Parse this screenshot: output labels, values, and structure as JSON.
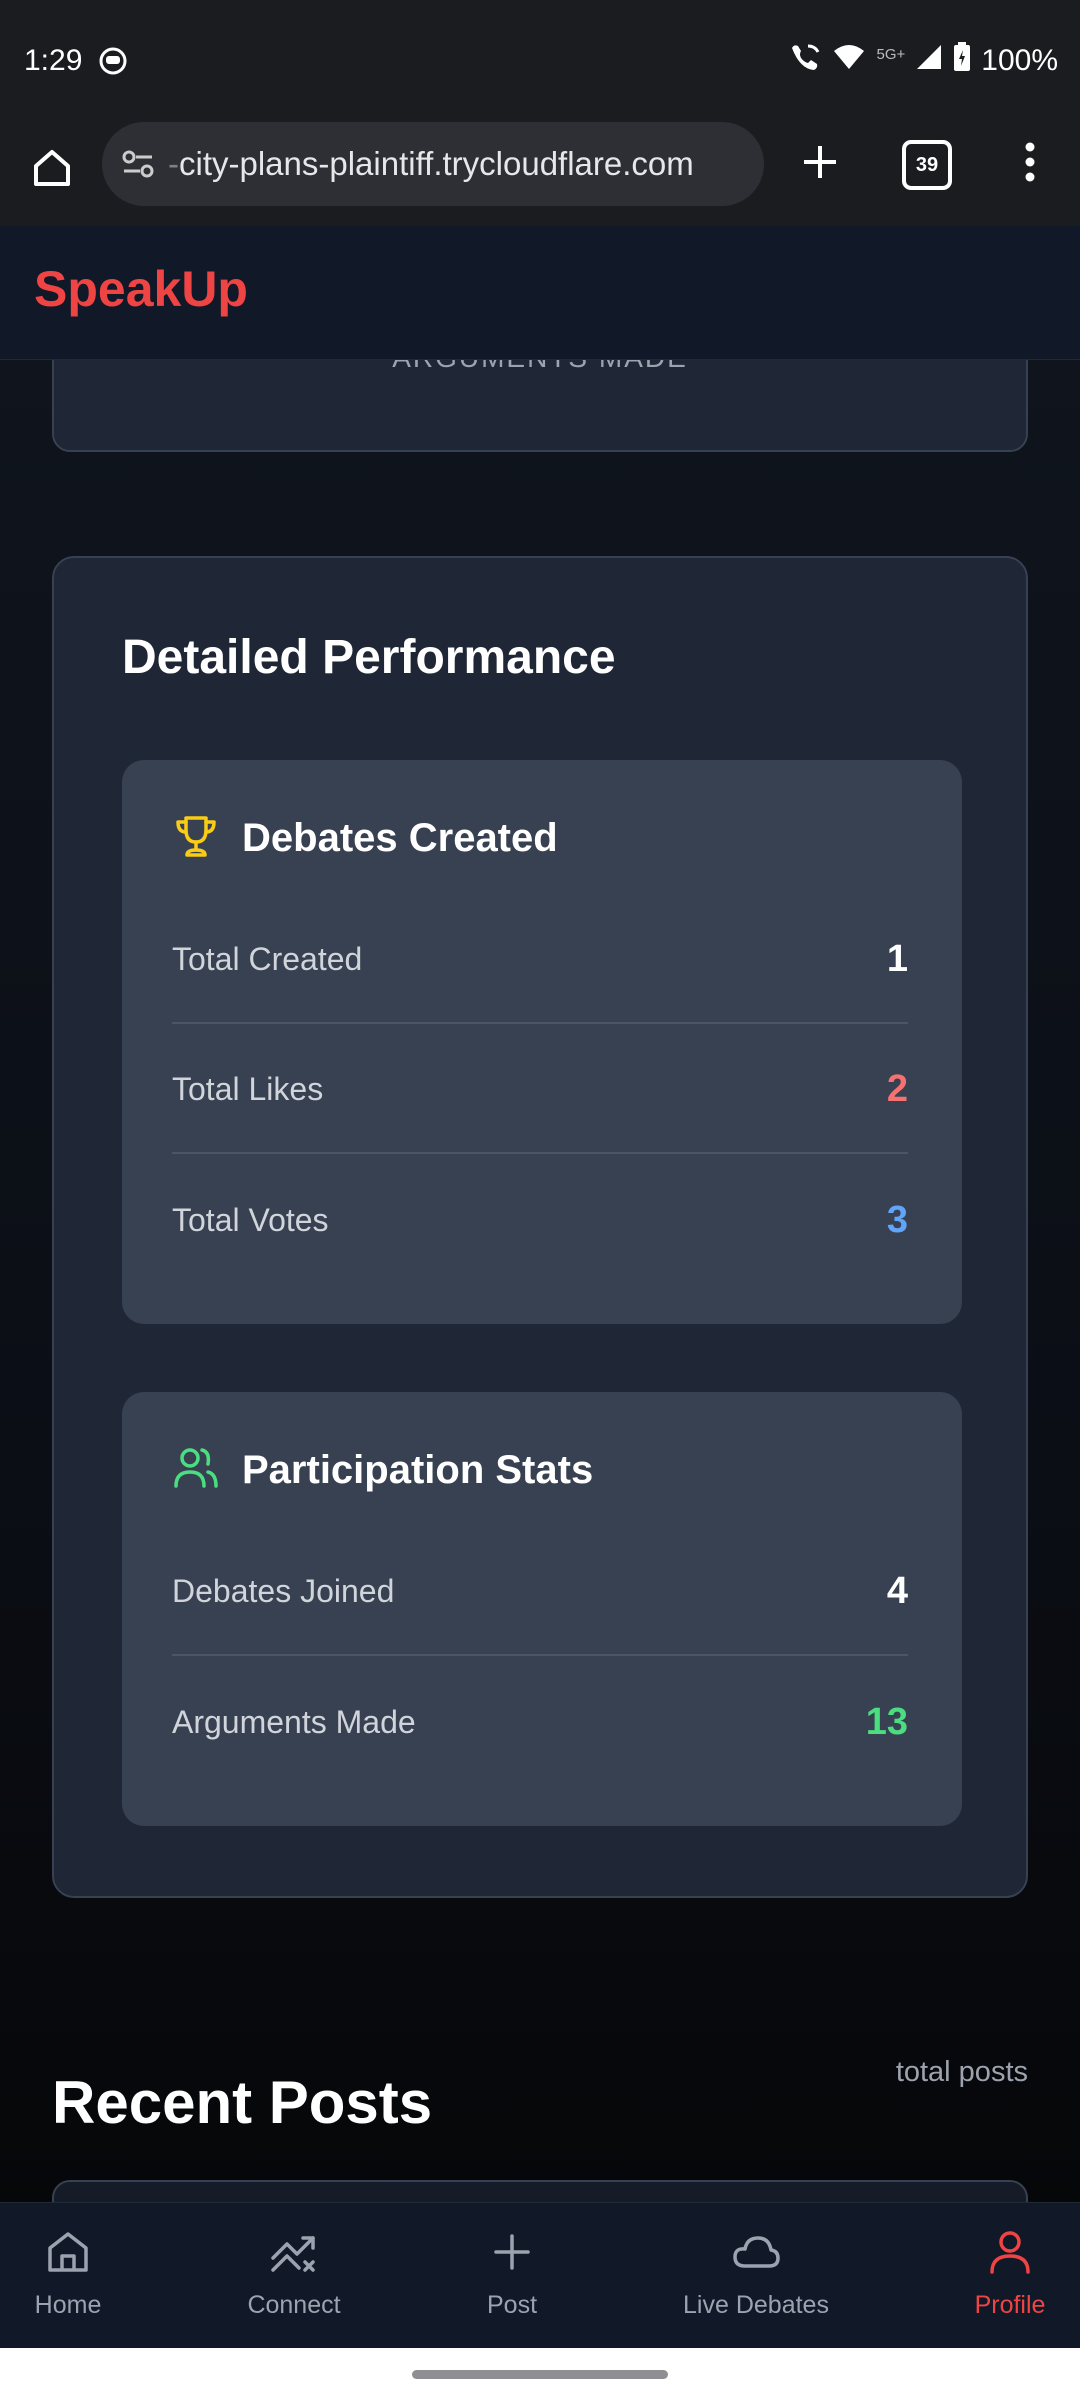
{
  "status_bar": {
    "time": "1:29",
    "network": "5G+",
    "battery": "100%"
  },
  "browser": {
    "url_prefix": "-",
    "url": "city-plans-plaintiff.trycloudflare.com",
    "tab_count": "39"
  },
  "app": {
    "logo": "SpeakUp"
  },
  "previous_card": {
    "label": "ARGUMENTS MADE"
  },
  "performance": {
    "title": "Detailed Performance",
    "debates_created": {
      "title": "Debates Created",
      "rows": [
        {
          "label": "Total Created",
          "value": "1"
        },
        {
          "label": "Total Likes",
          "value": "2"
        },
        {
          "label": "Total Votes",
          "value": "3"
        }
      ]
    },
    "participation": {
      "title": "Participation Stats",
      "rows": [
        {
          "label": "Debates Joined",
          "value": "4"
        },
        {
          "label": "Arguments Made",
          "value": "13"
        }
      ]
    }
  },
  "recent_posts": {
    "title": "Recent Posts",
    "count_label": "total posts"
  },
  "bottom_nav": {
    "items": [
      {
        "label": "Home",
        "icon": "home-icon"
      },
      {
        "label": "Connect",
        "icon": "trending-icon"
      },
      {
        "label": "Post",
        "icon": "plus-icon"
      },
      {
        "label": "Live Debates",
        "icon": "cloud-icon"
      },
      {
        "label": "Profile",
        "icon": "user-icon"
      }
    ],
    "active": "Profile"
  },
  "colors": {
    "brand": "#ef4444",
    "likes": "#f87171",
    "votes": "#60a5fa",
    "arguments": "#4ade80",
    "trophy": "#facc15"
  }
}
